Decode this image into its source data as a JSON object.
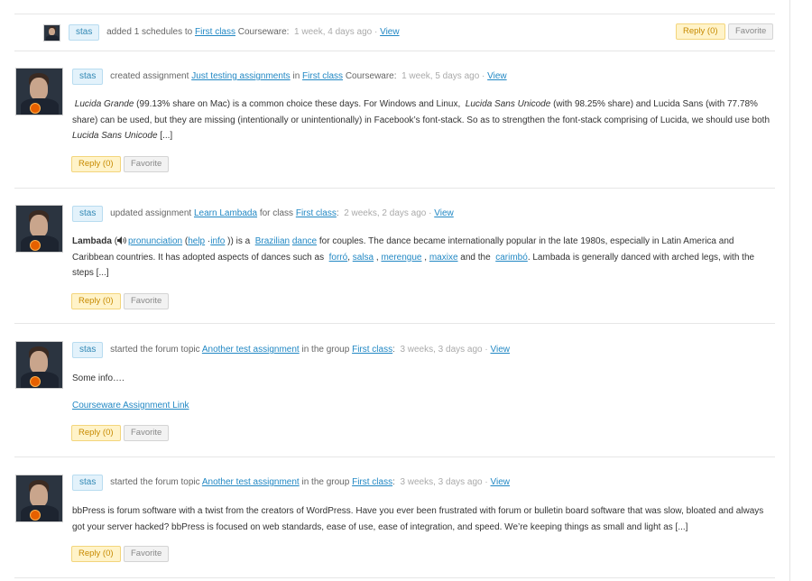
{
  "activity": [
    {
      "user": "stas",
      "action_pre": "added 1 schedules to",
      "link1": "First class",
      "action_post": "Courseware:",
      "time": "1 week, 4 days ago",
      "view": "View",
      "reply": "Reply (0)",
      "favorite": "Favorite"
    },
    {
      "user": "stas",
      "action_pre": "created assignment",
      "link1": "Just testing assignments",
      "action_mid": "in",
      "link2": "First class",
      "action_post": "Courseware:",
      "time": "1 week, 5 days ago",
      "view": "View",
      "body": {
        "t1": "Lucida Grande",
        "t2": "(99.13% share on Mac) is a common choice these days. For Windows and Linux,",
        "t3": "Lucida Sans Unicode",
        "t4": "(with 98.25% share) and Lucida Sans (with 77.78% share) can be used, but they are missing (intentionally or unintentionally) in Facebook’s font-stack. So as to strengthen the font-stack comprising of Lucida, we should use both",
        "t5": "Lucida Sans Unicode",
        "t6": "[...]"
      },
      "reply": "Reply (0)",
      "favorite": "Favorite"
    },
    {
      "user": "stas",
      "action_pre": "updated assignment",
      "link1": "Learn Lambada",
      "action_mid": "for class",
      "link2": "First class",
      "action_post": ":",
      "time": "2 weeks, 2 days ago",
      "view": "View",
      "body": {
        "bold": "Lambada",
        "open": "(",
        "l_pron": "pronunciation",
        "help_open": "(",
        "l_help": "help",
        "sep": "·",
        "l_info": "info",
        "close": "))",
        "is_a": "is a",
        "l_braz": "Brazilian",
        "l_dance": "dance",
        "t1": "for couples. The dance became internationally popular in the late 1980s, especially in Latin America and Caribbean countries. It has adopted aspects of dances such as",
        "l_forro": "forró",
        "c1": ",",
        "l_salsa": "salsa",
        "c2": ",",
        "l_merengue": "merengue",
        "c3": ",",
        "l_maxixe": "maxixe",
        "and_the": "and the",
        "l_carimbo": "carimbó",
        "t2": ". Lambada is generally danced with arched legs, with the steps [...]"
      },
      "reply": "Reply (0)",
      "favorite": "Favorite"
    },
    {
      "user": "stas",
      "action_pre": "started the forum topic",
      "link1": "Another test assignment",
      "action_mid": "in the group",
      "link2": "First class",
      "action_post": ":",
      "time": "3 weeks, 3 days ago",
      "view": "View",
      "body": {
        "text": "Some info….",
        "link": "Courseware Assignment Link"
      },
      "reply": "Reply (0)",
      "favorite": "Favorite"
    },
    {
      "user": "stas",
      "action_pre": "started the forum topic",
      "link1": "Another test assignment",
      "action_mid": "in the group",
      "link2": "First class",
      "action_post": ":",
      "time": "3 weeks, 3 days ago",
      "view": "View",
      "body": {
        "text": "bbPress is forum software with a twist from the creators of WordPress. Have you ever been frustrated with forum or bulletin board software that was slow, bloated and always got your server hacked? bbPress is focused on web standards, ease of use, ease of integration, and speed. We’re keeping things as small and light as [...]"
      },
      "reply": "Reply (0)",
      "favorite": "Favorite"
    }
  ],
  "icons": {
    "avatar": "user-avatar-photo",
    "speaker": "speaker-icon"
  },
  "colors": {
    "link": "#2288c4",
    "badge_bg": "#e3f2fb",
    "reply_bg": "#fff3c9",
    "fav_bg": "#f2f2f2"
  }
}
